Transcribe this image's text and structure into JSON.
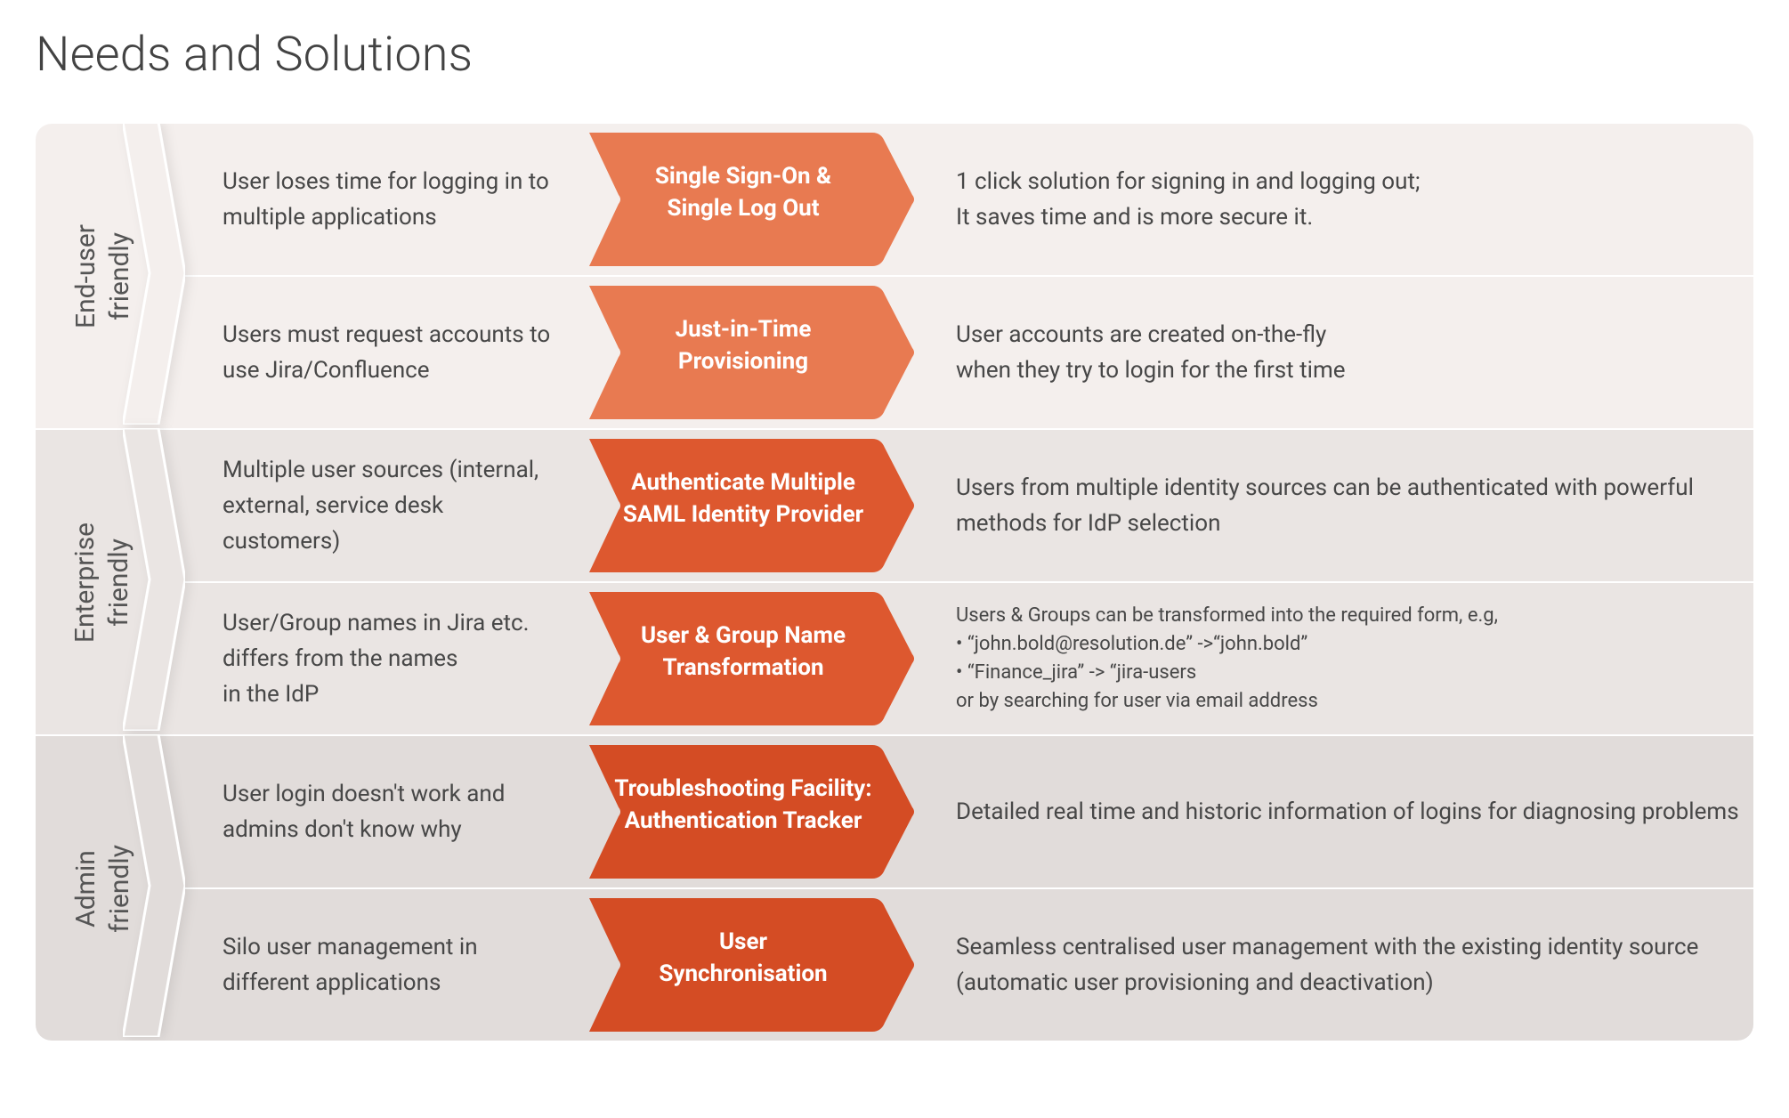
{
  "title": "Needs and Solutions",
  "colors": {
    "arrow_light": "#e87a51",
    "arrow_mid": "#dd582f",
    "arrow_dark": "#d44c24"
  },
  "categories": [
    {
      "label": "End-user\nfriendly",
      "bg": "bg-a",
      "chevron_fill": "#f4efed",
      "rows": [
        {
          "problem": "User loses time for logging in to multiple applications",
          "solution": "Single Sign-On &\nSingle Log Out",
          "benefit": "1 click solution for signing in and logging out;\nIt saves time and is more secure it.",
          "arrow_color": "arrow_light"
        },
        {
          "problem": "Users must request accounts to use Jira/Confluence",
          "solution": "Just-in-Time\nProvisioning",
          "benefit": "User accounts are created on-the-fly\nwhen they try to login for the first time",
          "arrow_color": "arrow_light"
        }
      ]
    },
    {
      "label": "Enterprise\nfriendly",
      "bg": "bg-b",
      "chevron_fill": "#eae5e3",
      "rows": [
        {
          "problem": "Multiple user sources (internal, external, service desk customers)",
          "solution": "Authenticate Multiple\nSAML Identity Provider",
          "benefit": "Users from multiple identity sources can be authenticated with powerful methods for IdP selection",
          "arrow_color": "arrow_mid"
        },
        {
          "problem": "User/Group names in Jira etc. differs from the names\nin the IdP",
          "solution": "User & Group Name\nTransformation",
          "benefit": "Users & Groups can be transformed into the required form, e.g,\n• “john.bold@resolution.de” ->“john.bold”\n• “Finance_jira” -> “jira-users\nor by searching for user via email address",
          "benefit_small": true,
          "arrow_color": "arrow_mid"
        }
      ]
    },
    {
      "label": "Admin\nfriendly",
      "bg": "bg-c",
      "chevron_fill": "#e1dcda",
      "rows": [
        {
          "problem": "User login doesn't work and admins don't know why",
          "solution": "Troubleshooting Facility:\nAuthentication Tracker",
          "benefit": "Detailed real time and historic information of logins for diagnosing problems",
          "arrow_color": "arrow_dark"
        },
        {
          "problem": "Silo user management in different applications",
          "solution": "User\nSynchronisation",
          "benefit": "Seamless centralised  user management with the existing identity source (automatic user provisioning and deactivation)",
          "arrow_color": "arrow_dark"
        }
      ]
    }
  ]
}
